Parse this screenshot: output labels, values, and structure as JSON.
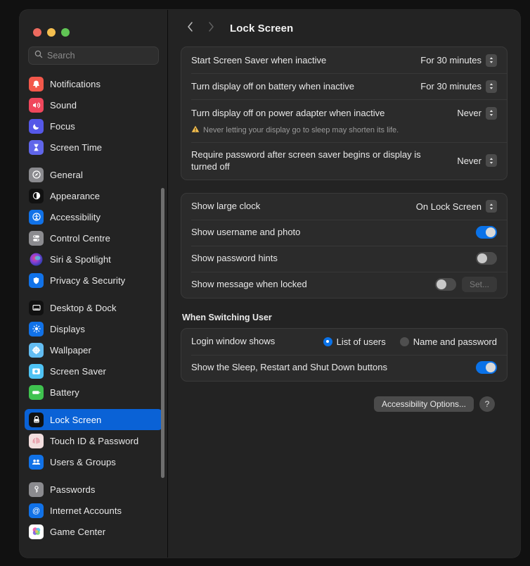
{
  "window": {
    "traffic_lights": [
      "close",
      "minimize",
      "zoom"
    ],
    "colors": {
      "accent_blue": "#0a72e8",
      "selected_sidebar": "#0a62d6",
      "window_bg": "#232323",
      "group_bg": "#2b2b2b",
      "warning_yellow": "#f5bf4f"
    }
  },
  "sidebar": {
    "search": {
      "placeholder": "Search",
      "value": "",
      "icon": "search-icon"
    },
    "groups": [
      {
        "items": [
          {
            "label": "Notifications",
            "icon": "notifications-icon"
          },
          {
            "label": "Sound",
            "icon": "sound-icon"
          },
          {
            "label": "Focus",
            "icon": "focus-icon"
          },
          {
            "label": "Screen Time",
            "icon": "screen-time-icon"
          }
        ]
      },
      {
        "items": [
          {
            "label": "General",
            "icon": "general-icon"
          },
          {
            "label": "Appearance",
            "icon": "appearance-icon"
          },
          {
            "label": "Accessibility",
            "icon": "accessibility-icon"
          },
          {
            "label": "Control Centre",
            "icon": "control-centre-icon"
          },
          {
            "label": "Siri & Spotlight",
            "icon": "siri-icon"
          },
          {
            "label": "Privacy & Security",
            "icon": "privacy-security-icon"
          }
        ]
      },
      {
        "items": [
          {
            "label": "Desktop & Dock",
            "icon": "desktop-dock-icon"
          },
          {
            "label": "Displays",
            "icon": "displays-icon"
          },
          {
            "label": "Wallpaper",
            "icon": "wallpaper-icon"
          },
          {
            "label": "Screen Saver",
            "icon": "screen-saver-icon"
          },
          {
            "label": "Battery",
            "icon": "battery-icon"
          }
        ]
      },
      {
        "items": [
          {
            "label": "Lock Screen",
            "icon": "lock-screen-icon",
            "selected": true
          },
          {
            "label": "Touch ID & Password",
            "icon": "touch-id-icon"
          },
          {
            "label": "Users & Groups",
            "icon": "users-groups-icon"
          }
        ]
      },
      {
        "items": [
          {
            "label": "Passwords",
            "icon": "passwords-icon"
          },
          {
            "label": "Internet Accounts",
            "icon": "internet-accounts-icon"
          },
          {
            "label": "Game Center",
            "icon": "game-center-icon"
          }
        ]
      }
    ]
  },
  "toolbar": {
    "back_icon": "chevron-left-icon",
    "forward_icon": "chevron-right-icon",
    "title": "Lock Screen"
  },
  "main": {
    "group_timers": {
      "rows": [
        {
          "label": "Start Screen Saver when inactive",
          "value": "For 30 minutes"
        },
        {
          "label": "Turn display off on battery when inactive",
          "value": "For 30 minutes"
        },
        {
          "label": "Turn display off on power adapter when inactive",
          "value": "Never",
          "warning": "Never letting your display go to sleep may shorten its life."
        },
        {
          "label": "Require password after screen saver begins or display is turned off",
          "value": "Never"
        }
      ]
    },
    "group_display": {
      "rows": [
        {
          "label": "Show large clock",
          "value": "On Lock Screen",
          "type": "popup"
        },
        {
          "label": "Show username and photo",
          "type": "switch",
          "on": true
        },
        {
          "label": "Show password hints",
          "type": "switch",
          "on": false
        },
        {
          "label": "Show message when locked",
          "type": "switch",
          "on": false,
          "button": "Set...",
          "button_disabled": true
        }
      ]
    },
    "switching_user": {
      "title": "When Switching User",
      "login_window": {
        "label": "Login window shows",
        "options": [
          {
            "label": "List of users",
            "checked": true
          },
          {
            "label": "Name and password",
            "checked": false
          }
        ]
      },
      "sleep_buttons": {
        "label": "Show the Sleep, Restart and Shut Down buttons",
        "on": true
      }
    },
    "footer": {
      "accessibility_options": "Accessibility Options...",
      "help": "?"
    }
  }
}
